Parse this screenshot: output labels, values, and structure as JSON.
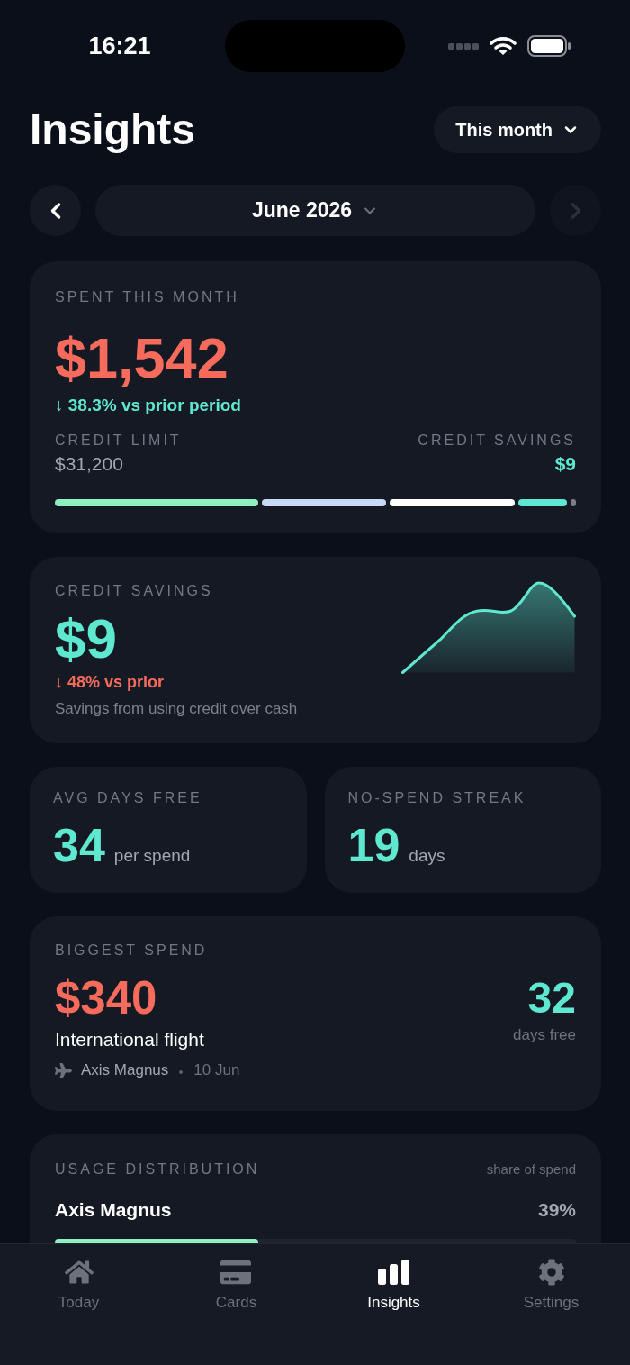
{
  "status_bar": {
    "time": "16:21"
  },
  "header": {
    "title": "Insights",
    "period_button": {
      "label": "This month"
    }
  },
  "month_nav": {
    "previous": {
      "disabled": false
    },
    "month": "June 2026",
    "next": {
      "disabled": true
    }
  },
  "spent_card": {
    "label": "SPENT THIS MONTH",
    "amount": "$1,542",
    "change": {
      "text": "↓ 38.3% vs prior period",
      "favorable": true
    },
    "credit_limit": {
      "label": "CREDIT LIMIT",
      "value": "$31,200"
    },
    "credit_savings": {
      "label": "CREDIT SAVINGS",
      "value": "$9"
    }
  },
  "savings_card": {
    "label": "CREDIT SAVINGS",
    "amount": "$9",
    "change": {
      "text": "↓ 48% vs prior",
      "favorable": false
    },
    "note": "Savings from using credit over cash"
  },
  "stats": [
    {
      "label": "AVG DAYS FREE",
      "value": "34",
      "unit": "per spend"
    },
    {
      "label": "NO-SPEND STREAK",
      "value": "19",
      "unit": "days"
    }
  ],
  "biggest_spend": {
    "label": "BIGGEST SPEND",
    "amount": "$340",
    "title": "International flight",
    "card": "Axis Magnus",
    "date": "10 Jun",
    "days_value": "32",
    "days_label": "days free"
  },
  "usage": {
    "label": "USAGE DISTRIBUTION",
    "hint": "share of spend",
    "rows": [
      {
        "name": "Axis Magnus",
        "share": "39%",
        "level": 0.39
      }
    ]
  },
  "tab_bar": {
    "tabs": [
      {
        "label": "Today",
        "selected": false
      },
      {
        "label": "Cards",
        "selected": false
      },
      {
        "label": "Insights",
        "selected": true
      },
      {
        "label": "Settings",
        "selected": false
      }
    ]
  }
}
